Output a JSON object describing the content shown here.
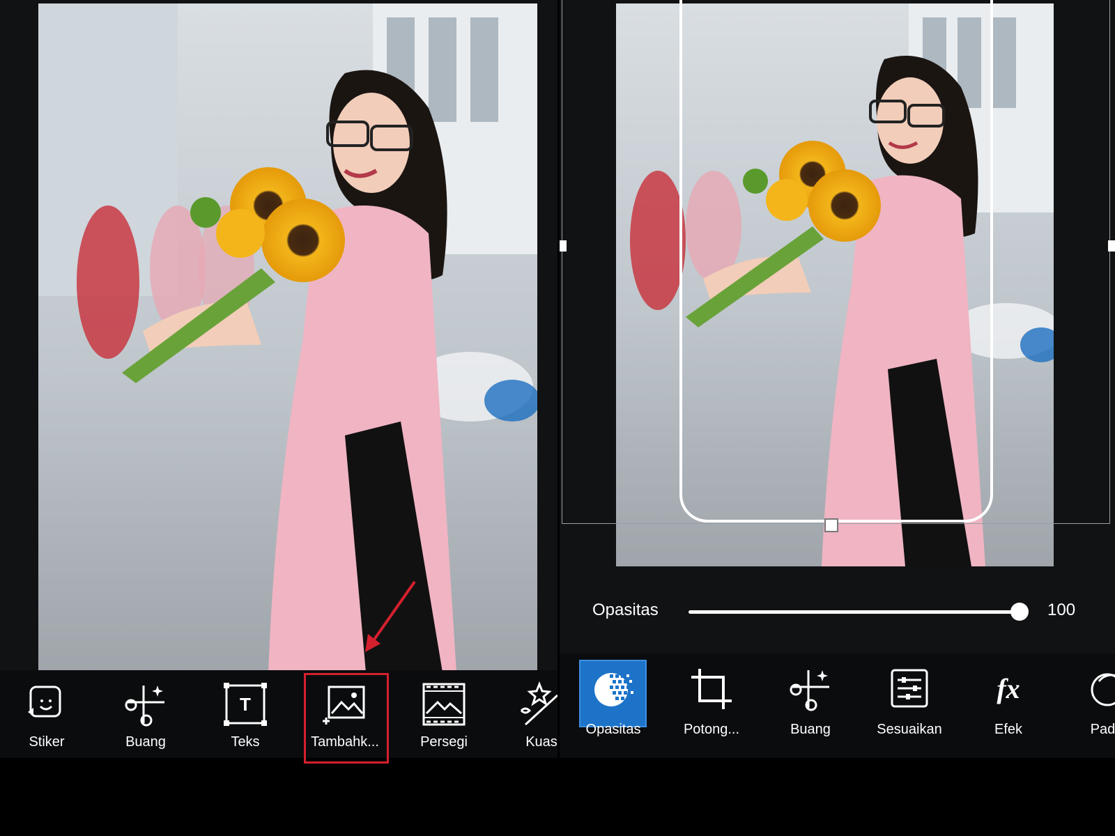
{
  "left_toolbar": {
    "items": [
      {
        "label": "Stiker",
        "icon": "sticker-icon"
      },
      {
        "label": "Buang",
        "icon": "remove-scissors-icon"
      },
      {
        "label": "Teks",
        "icon": "text-icon"
      },
      {
        "label": "Tambahk...",
        "icon": "add-photo-icon",
        "highlighted": true
      },
      {
        "label": "Persegi",
        "icon": "square-fit-icon"
      },
      {
        "label": "Kuas",
        "icon": "brush-icon"
      }
    ]
  },
  "right_panel": {
    "opacity": {
      "label": "Opasitas",
      "value": "100",
      "level": 1.0
    }
  },
  "right_toolbar": {
    "items": [
      {
        "label": "Opasitas",
        "icon": "opacity-icon",
        "active": true
      },
      {
        "label": "Potong...",
        "icon": "crop-icon"
      },
      {
        "label": "Buang",
        "icon": "remove-scissors-icon"
      },
      {
        "label": "Sesuaikan",
        "icon": "adjust-icon"
      },
      {
        "label": "Efek",
        "icon": "fx-icon"
      },
      {
        "label": "Padu",
        "icon": "blend-icon"
      }
    ]
  },
  "colors": {
    "highlight": "#d5202e",
    "active_tab": "#1d73c8",
    "background": "#111214"
  }
}
